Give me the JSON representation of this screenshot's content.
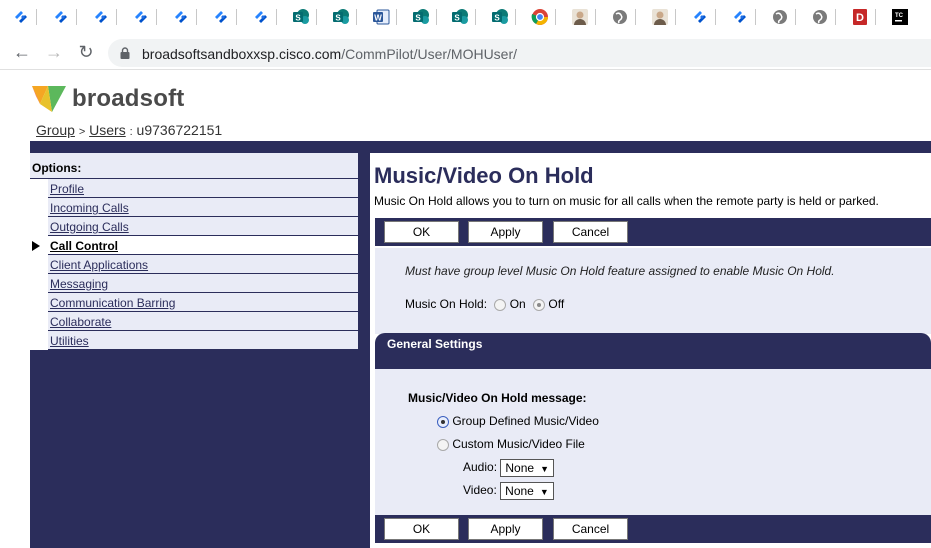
{
  "bookmarks": [
    {
      "icon": "jira-icon"
    },
    {
      "icon": "jira-icon"
    },
    {
      "icon": "jira-icon"
    },
    {
      "icon": "jira-icon"
    },
    {
      "icon": "jira-icon"
    },
    {
      "icon": "jira-icon"
    },
    {
      "icon": "jira-icon"
    },
    {
      "icon": "sharepoint-icon"
    },
    {
      "icon": "sharepoint-icon"
    },
    {
      "icon": "word-icon"
    },
    {
      "icon": "sharepoint-icon"
    },
    {
      "icon": "sharepoint-icon"
    },
    {
      "icon": "sharepoint-icon"
    },
    {
      "icon": "chrome-icon"
    },
    {
      "icon": "avatar-icon"
    },
    {
      "icon": "globe-icon"
    },
    {
      "icon": "avatar-icon"
    },
    {
      "icon": "jira-icon"
    },
    {
      "icon": "jira-icon"
    },
    {
      "icon": "globe-icon"
    },
    {
      "icon": "globe-icon"
    },
    {
      "icon": "dash-icon"
    },
    {
      "icon": "teamcity-icon"
    }
  ],
  "address_bar": {
    "host": "broadsoftsandboxxsp.cisco.com",
    "path": "/CommPilot/User/MOHUser/"
  },
  "brand": {
    "name": "broadsoft",
    "navy": "#2b2d5b",
    "panel_bg": "#e9ebf6"
  },
  "breadcrumb": {
    "group": "Group",
    "sep": ">",
    "users": "Users",
    "colon": ":",
    "user_id": "u9736722151"
  },
  "options": {
    "title": "Options:",
    "items": [
      {
        "label": "Profile",
        "active": false
      },
      {
        "label": "Incoming Calls",
        "active": false
      },
      {
        "label": "Outgoing Calls",
        "active": false
      },
      {
        "label": "Call Control",
        "active": true
      },
      {
        "label": "Client Applications",
        "active": false
      },
      {
        "label": "Messaging",
        "active": false
      },
      {
        "label": "Communication Barring",
        "active": false
      },
      {
        "label": "Collaborate",
        "active": false
      },
      {
        "label": "Utilities",
        "active": false
      }
    ]
  },
  "main": {
    "title": "Music/Video On Hold",
    "description": "Music On Hold allows you to turn on music for all calls when the remote party is held or parked.",
    "buttons": {
      "ok": "OK",
      "apply": "Apply",
      "cancel": "Cancel"
    },
    "note": "Must have group level Music On Hold feature assigned to enable Music On Hold.",
    "moh_label": "Music On Hold:",
    "moh_on": "On",
    "moh_off": "Off",
    "moh_value": "Off",
    "general_settings": "General Settings",
    "message_label": "Music/Video On Hold message:",
    "group_defined": "Group Defined Music/Video",
    "custom_file": "Custom Music/Video File",
    "message_value": "Group Defined Music/Video",
    "audio_label": "Audio:",
    "audio_value": "None",
    "video_label": "Video:",
    "video_value": "None"
  }
}
